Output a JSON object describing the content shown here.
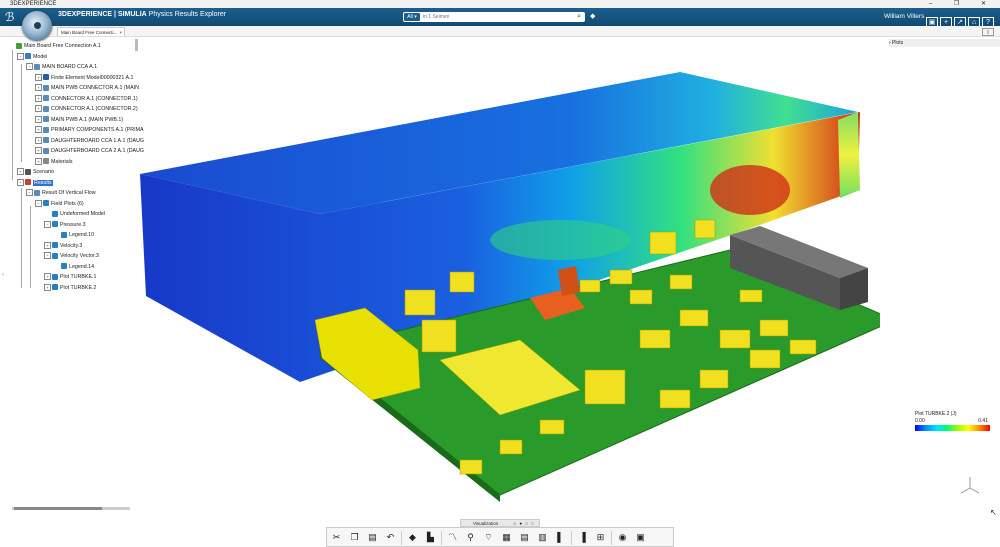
{
  "window": {
    "app_name": "3DEXPERIENCE",
    "controls": "–  ❐  ✕"
  },
  "topbar": {
    "brand_main": "3DEXPERIENCE | SIMULIA",
    "brand_app": " Physics Results Explorer",
    "search_scope": "All ▾",
    "search_placeholder": "in 1 Seimen",
    "user_name": "William Villers",
    "icons": [
      "▣",
      "+",
      "↗",
      "⌂",
      "?"
    ]
  },
  "tab": {
    "title": "Main Board Free Connecti...",
    "close": "×"
  },
  "tree": [
    {
      "label": "Main Board Free Connection A.1",
      "exp": "",
      "color": "#4a9a3a"
    },
    {
      "label": "Model",
      "exp": "−",
      "color": "#3a78c8"
    },
    {
      "label": "MAIN BOARD CCA A.1",
      "exp": "−",
      "color": "#5a8ab8"
    },
    {
      "label": "Finite Element Model00000321 A.1",
      "exp": "+",
      "color": "#2a5f9f"
    },
    {
      "label": "MAIN PWB CONNECTOR A.1 (MAIN",
      "exp": "+",
      "color": "#5a8ab8"
    },
    {
      "label": "CONNECTOR A.1 (CONNECTOR.1)",
      "exp": "+",
      "color": "#5a8ab8"
    },
    {
      "label": "CONNECTOR A.1 (CONNECTOR.2)",
      "exp": "+",
      "color": "#5a8ab8"
    },
    {
      "label": "MAIN PWB A.1 (MAIN PWB.1)",
      "exp": "+",
      "color": "#5a8ab8"
    },
    {
      "label": "PRIMARY COMPONENTS A.1 (PRIMA",
      "exp": "+",
      "color": "#5a8ab8"
    },
    {
      "label": "DAUGHTERBOARD CCA 1 A.1 (DAUG",
      "exp": "+",
      "color": "#5a8ab8"
    },
    {
      "label": "DAUGHTERBOARD CCA 2 A.1 (DAUG",
      "exp": "+",
      "color": "#5a8ab8"
    },
    {
      "label": "Materials",
      "exp": "+",
      "color": "#888888"
    },
    {
      "label": "Scenario",
      "exp": "+",
      "color": "#555555"
    },
    {
      "label": "Results",
      "exp": "−",
      "color": "#c84030"
    },
    {
      "label": "Result Of Vertical Flow",
      "exp": "−",
      "color": "#5a8ab8"
    },
    {
      "label": "Field Plots (6)",
      "exp": "−",
      "color": "#2a7fc0"
    },
    {
      "label": "Undeformed Model",
      "exp": "",
      "color": "#2a7fc0"
    },
    {
      "label": "Pressure.3",
      "exp": "−",
      "color": "#2a7fc0"
    },
    {
      "label": "Legend.10",
      "exp": "",
      "color": "#2a7fc0"
    },
    {
      "label": "Velocity.3",
      "exp": "+",
      "color": "#2a7fc0"
    },
    {
      "label": "Velocity Vector.3",
      "exp": "−",
      "color": "#2a7fc0"
    },
    {
      "label": "Legend.14",
      "exp": "",
      "color": "#2a7fc0"
    },
    {
      "label": "Plot TURBKE.1",
      "exp": "+",
      "color": "#2a7fc0"
    },
    {
      "label": "Plot TURBKE.2",
      "exp": "+",
      "color": "#2a7fc0"
    }
  ],
  "plots_panel": {
    "label": "› Plots"
  },
  "legend": {
    "title": "Plot TURBKE.2 (J)",
    "min": "0.00",
    "max": "0.41"
  },
  "viz_tab": {
    "label": "Visualization",
    "dots": "○ ● ○ ○"
  },
  "toolbar_icons": [
    "✂",
    "❐",
    "▤",
    "↶",
    "◆",
    "▙",
    "〽",
    "⚲",
    "⌔",
    "▦",
    "▤",
    "▥",
    "▌",
    "▐",
    "⊞",
    "◉",
    "▣"
  ]
}
